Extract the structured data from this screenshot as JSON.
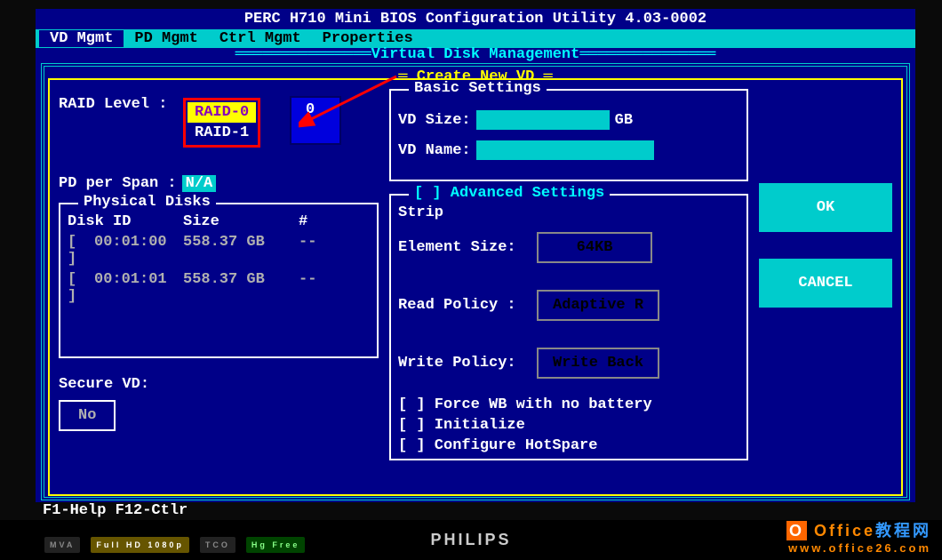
{
  "title": "PERC H710 Mini BIOS Configuration Utility 4.03-0002",
  "menu": {
    "vd": "VD Mgmt",
    "pd": "PD Mgmt",
    "ctrl": "Ctrl Mgmt",
    "props": "Properties"
  },
  "section_title": "Virtual Disk Management",
  "dialog_title": "Create New VD",
  "left": {
    "raid_label": "RAID Level :",
    "raid_options": {
      "r0": "RAID-0",
      "r1": "RAID-1"
    },
    "behind_value": "0",
    "pd_span_label": "PD per Span :",
    "pd_span_value": "N/A",
    "pd_legend": "Physical Disks",
    "pd_headers": {
      "id": "Disk ID",
      "size": "Size",
      "num": "#"
    },
    "disks": [
      {
        "sel": "[ ]",
        "id": "00:01:00",
        "size": "558.37 GB",
        "num": "--"
      },
      {
        "sel": "[ ]",
        "id": "00:01:01",
        "size": "558.37 GB",
        "num": "--"
      }
    ],
    "secure_label": "Secure VD:",
    "secure_value": "No"
  },
  "basic": {
    "legend": "Basic Settings",
    "vd_size_label": "VD Size:",
    "vd_size_unit": "GB",
    "vd_name_label": "VD Name:"
  },
  "adv": {
    "legend": "[ ] Advanced Settings",
    "strip_label1": "Strip",
    "strip_label2": "Element Size:",
    "strip_value": "64KB",
    "read_label": "Read Policy :",
    "read_value": "Adaptive R",
    "write_label": "Write Policy:",
    "write_value": "Write Back",
    "cb1": "[ ] Force WB with no battery",
    "cb2": "[ ] Initialize",
    "cb3": "[ ] Configure HotSpare"
  },
  "buttons": {
    "ok": "OK",
    "cancel": "CANCEL"
  },
  "footer": "F1-Help F12-Ctlr",
  "monitor_brand": "PHILIPS",
  "badges": {
    "mva": "MVA",
    "fhd": "Full HD 1080p",
    "tco": "TCO",
    "hg": "Hg Free"
  },
  "watermark": {
    "line1a": "Office",
    "line1b": "教程网",
    "line2": "www.office26.com"
  }
}
